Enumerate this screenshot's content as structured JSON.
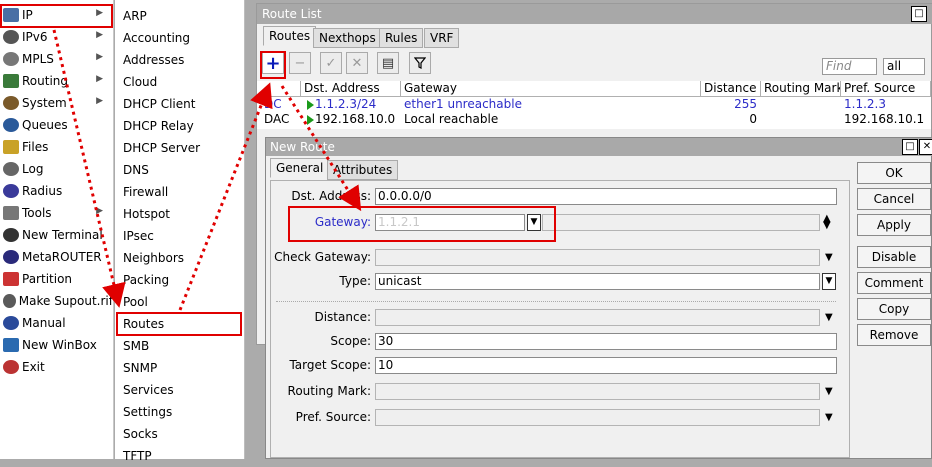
{
  "left_menu": {
    "items": [
      {
        "label": "IP",
        "icon": "ip-icon",
        "arrow": true
      },
      {
        "label": "IPv6",
        "icon": "ipv6-icon",
        "arrow": true
      },
      {
        "label": "MPLS",
        "icon": "mpls-icon",
        "arrow": true
      },
      {
        "label": "Routing",
        "icon": "routing-icon",
        "arrow": true
      },
      {
        "label": "System",
        "icon": "system-icon",
        "arrow": true
      },
      {
        "label": "Queues",
        "icon": "queues-icon",
        "arrow": false
      },
      {
        "label": "Files",
        "icon": "files-icon",
        "arrow": false
      },
      {
        "label": "Log",
        "icon": "log-icon",
        "arrow": false
      },
      {
        "label": "Radius",
        "icon": "radius-icon",
        "arrow": false
      },
      {
        "label": "Tools",
        "icon": "tools-icon",
        "arrow": true
      },
      {
        "label": "New Terminal",
        "icon": "terminal-icon",
        "arrow": false
      },
      {
        "label": "MetaROUTER",
        "icon": "metarouter-icon",
        "arrow": false
      },
      {
        "label": "Partition",
        "icon": "partition-icon",
        "arrow": false
      },
      {
        "label": "Make Supout.rif",
        "icon": "supout-icon",
        "arrow": false
      },
      {
        "label": "Manual",
        "icon": "manual-icon",
        "arrow": false
      },
      {
        "label": "New WinBox",
        "icon": "winbox-icon",
        "arrow": false
      },
      {
        "label": "Exit",
        "icon": "exit-icon",
        "arrow": false
      }
    ]
  },
  "submenu": {
    "items": [
      "ARP",
      "Accounting",
      "Addresses",
      "Cloud",
      "DHCP Client",
      "DHCP Relay",
      "DHCP Server",
      "DNS",
      "Firewall",
      "Hotspot",
      "IPsec",
      "Neighbors",
      "Packing",
      "Pool",
      "Routes",
      "SMB",
      "SNMP",
      "Services",
      "Settings",
      "Socks",
      "TFTP"
    ]
  },
  "route_list": {
    "title": "Route List",
    "tabs": [
      "Routes",
      "Nexthops",
      "Rules",
      "VRF"
    ],
    "find_placeholder": "Find",
    "filter_value": "all",
    "columns": [
      "Dst. Address",
      "Gateway",
      "Distance",
      "Routing Mark",
      "Pref. Source"
    ],
    "rows": [
      {
        "flags": "DC",
        "dst": "1.1.2.3/24",
        "gateway": "ether1 unreachable",
        "distance": "255",
        "routing_mark": "",
        "pref_source": "1.1.2.3",
        "color": "#2c2cc8"
      },
      {
        "flags": "DAC",
        "dst": "192.168.10.0",
        "gateway": "Local reachable",
        "distance": "0",
        "routing_mark": "",
        "pref_source": "192.168.10.1",
        "color": "#000000"
      }
    ]
  },
  "new_route": {
    "title": "New Route",
    "tabs": [
      "General",
      "Attributes"
    ],
    "fields": {
      "dst_address": {
        "label": "Dst. Address:",
        "value": "0.0.0.0/0"
      },
      "gateway": {
        "label": "Gateway:",
        "value": "1.1.2.1"
      },
      "check_gateway": {
        "label": "Check Gateway:",
        "value": ""
      },
      "type": {
        "label": "Type:",
        "value": "unicast"
      },
      "distance": {
        "label": "Distance:",
        "value": ""
      },
      "scope": {
        "label": "Scope:",
        "value": "30"
      },
      "target_scope": {
        "label": "Target Scope:",
        "value": "10"
      },
      "routing_mark": {
        "label": "Routing Mark:",
        "value": ""
      },
      "pref_source": {
        "label": "Pref. Source:",
        "value": ""
      }
    },
    "buttons": [
      "OK",
      "Cancel",
      "Apply",
      "Disable",
      "Comment",
      "Copy",
      "Remove"
    ]
  },
  "colors": {
    "highlight": "#e00000",
    "gateway_label": "#2c2cc8",
    "titlebar": "#a8a8a8"
  }
}
